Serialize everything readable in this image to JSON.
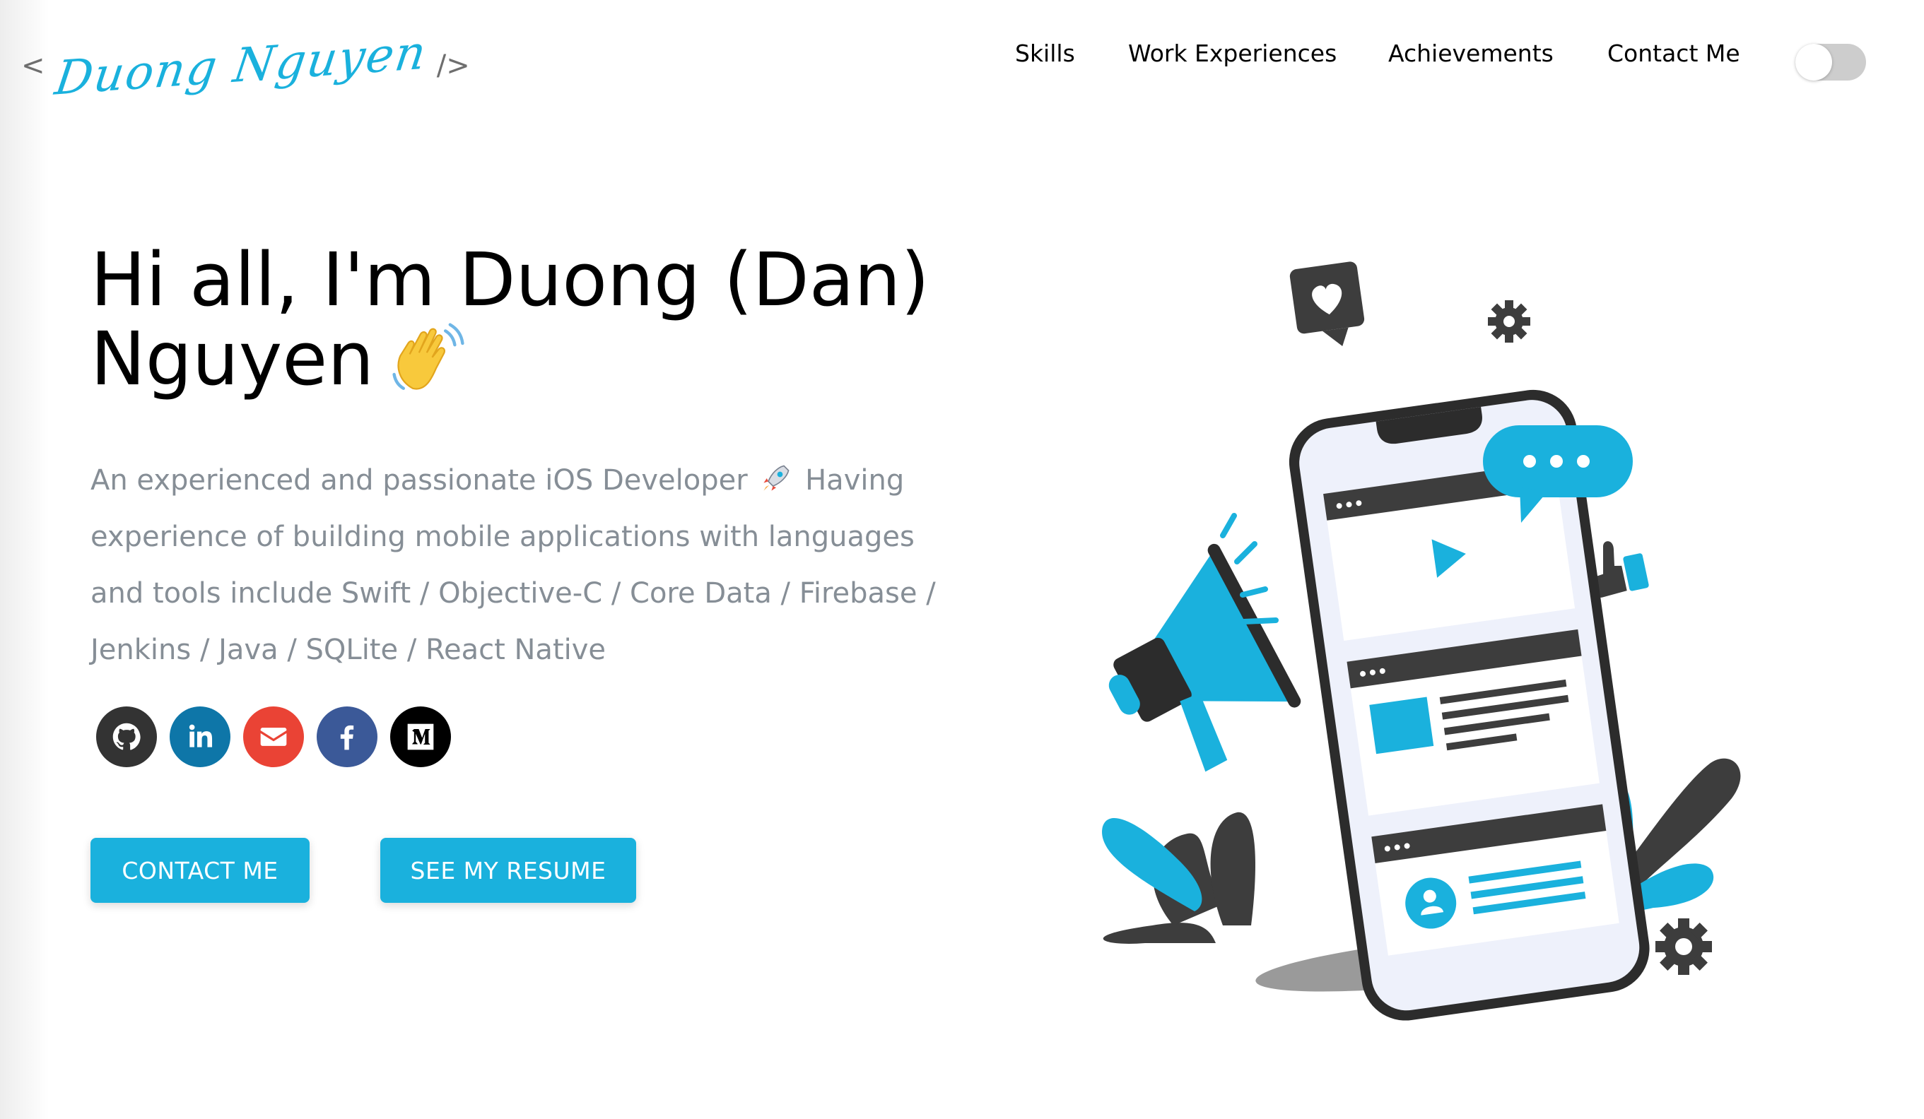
{
  "header": {
    "logo": {
      "open_bracket": "<",
      "name": "Duong Nguyen",
      "close_bracket": "/>"
    },
    "nav": [
      {
        "label": "Skills"
      },
      {
        "label": "Work Experiences"
      },
      {
        "label": "Achievements"
      },
      {
        "label": "Contact Me"
      }
    ],
    "theme_toggle": {
      "on": false
    }
  },
  "hero": {
    "greeting": "Hi all, I'm Duong (Dan) Nguyen",
    "subtitle_before_rocket": "An experienced and passionate iOS Developer",
    "subtitle_after_rocket": "Having experience of building mobile applications with languages and tools include Swift / Objective-C / Core Data / Firebase / Jenkins / Java / SQLite / React Native",
    "social_links": [
      {
        "icon": "github-icon",
        "color": "#333333"
      },
      {
        "icon": "linkedin-icon",
        "color": "#0e76a8"
      },
      {
        "icon": "email-icon",
        "color": "#ea4335"
      },
      {
        "icon": "facebook-icon",
        "color": "#3b5998"
      },
      {
        "icon": "medium-icon",
        "color": "#000000"
      }
    ],
    "buttons": {
      "contact": "CONTACT ME",
      "resume": "SEE MY RESUME"
    }
  },
  "colors": {
    "accent": "#1ab1dd",
    "subtitle_text": "#868e96",
    "dark": "#3d3d3d"
  }
}
